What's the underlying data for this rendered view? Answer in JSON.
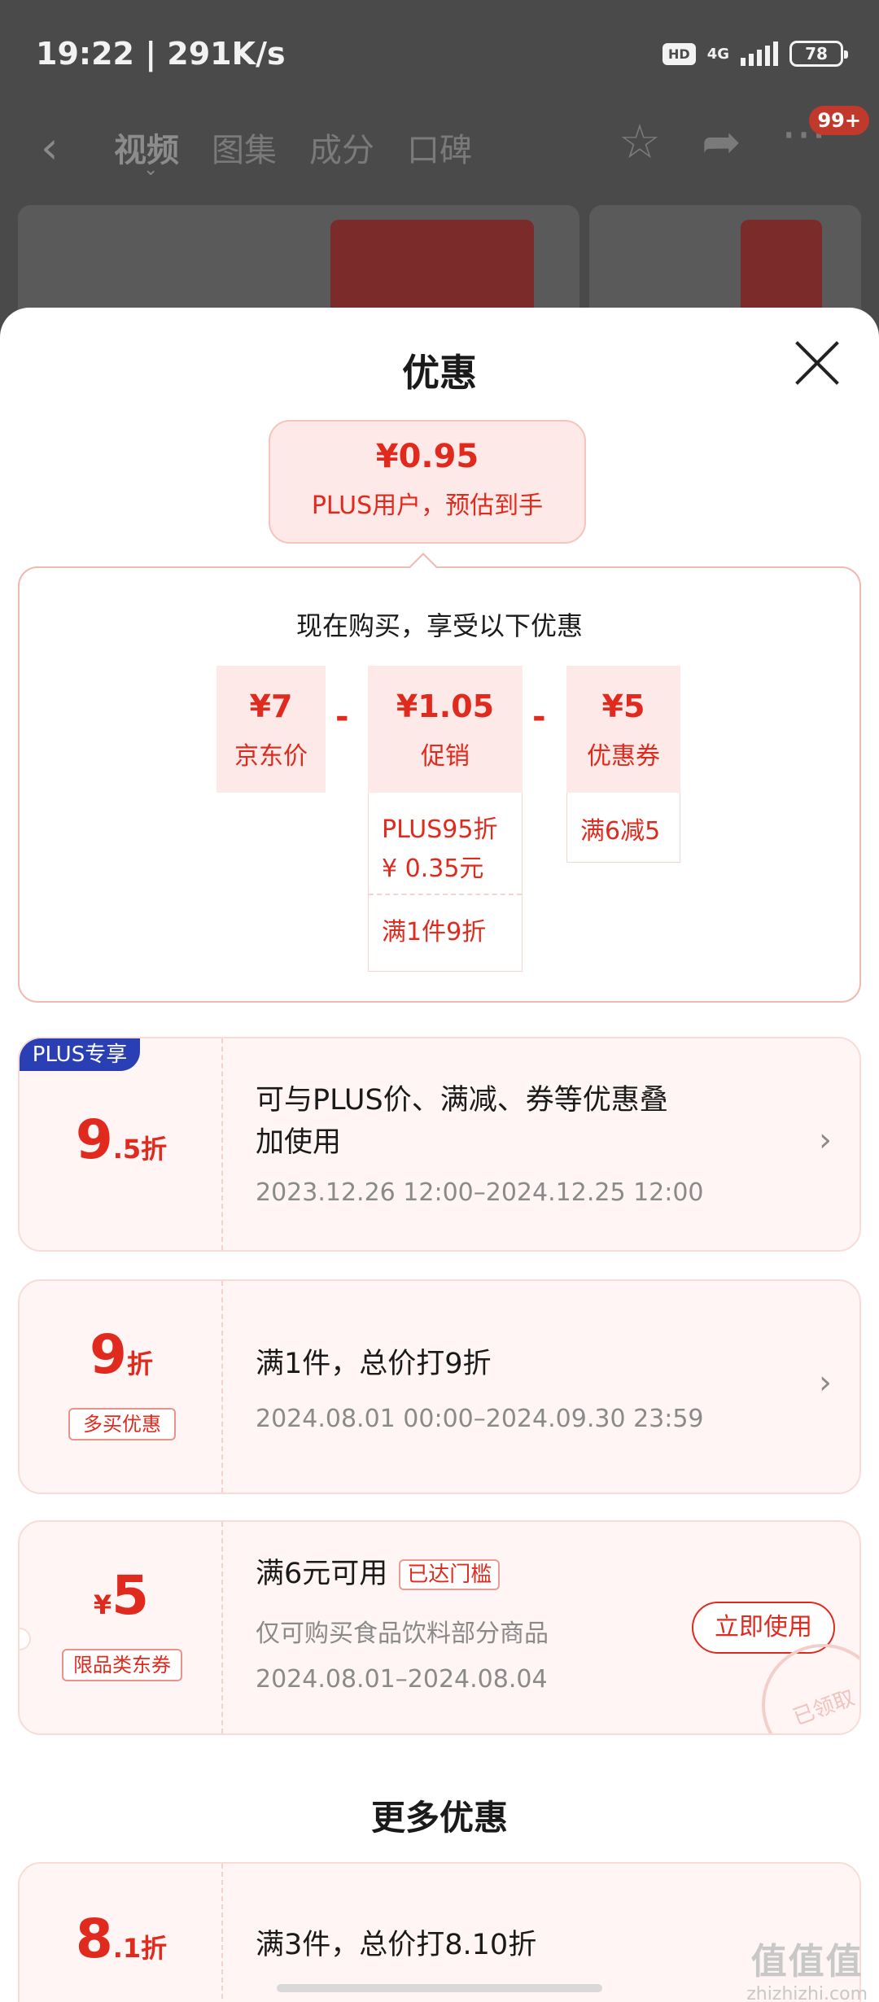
{
  "status_bar": {
    "time_speed": "19:22 | 291K/s",
    "hd": "HD",
    "network": "4G",
    "battery": "78"
  },
  "nav": {
    "back_icon": "chevron-left",
    "tabs": [
      "视频",
      "图集",
      "成分",
      "口碑"
    ],
    "active_tab": "视频",
    "star_icon": "star-outline",
    "share_icon": "share-arrow",
    "more_icon": "ellipsis",
    "badge": "99+"
  },
  "sheet": {
    "title": "优惠",
    "estimate": {
      "price": "¥0.95",
      "label": "PLUS用户，预估到手"
    },
    "breakdown": {
      "title": "现在购买，享受以下优惠",
      "items": [
        {
          "value": "¥7",
          "label": "京东价"
        },
        {
          "value": "¥1.05",
          "label": "促销"
        },
        {
          "value": "¥5",
          "label": "优惠券"
        }
      ],
      "operators": [
        "-",
        "-"
      ],
      "promo_details": [
        "PLUS95折",
        "¥ 0.35元",
        "满1件9折"
      ],
      "coupon_details": [
        "满6减5"
      ]
    },
    "coupons": [
      {
        "badge": "PLUS专享",
        "big": "9",
        "small": ".5折",
        "title_line1": "可与PLUS价、满减、券等优惠叠",
        "title_line2": "加使用",
        "date": "2023.12.26 12:00–2024.12.25 12:00"
      },
      {
        "big": "9",
        "small": "折",
        "tag": "多买优惠",
        "title": "满1件，总价打9折",
        "date": "2024.08.01 00:00–2024.09.30 23:59"
      },
      {
        "currency": "¥",
        "big": "5",
        "tag": "限品类东券",
        "title": "满6元可用",
        "status_tag": "已达门槛",
        "desc": "仅可购买食品饮料部分商品",
        "date": "2024.08.01–2024.08.04",
        "button": "立即使用",
        "stamp": "已领取"
      }
    ],
    "more_title": "更多优惠",
    "more_coupon": {
      "big": "8",
      "small": ".1折",
      "title": "满3件，总价打8.10折"
    }
  },
  "watermark": {
    "big": "值值值",
    "small": "zhizhizhi.com"
  },
  "colors": {
    "accent_red": "#e02a1e",
    "plus_blue": "#2b3fb5",
    "chip_bg": "#fde9e7"
  }
}
